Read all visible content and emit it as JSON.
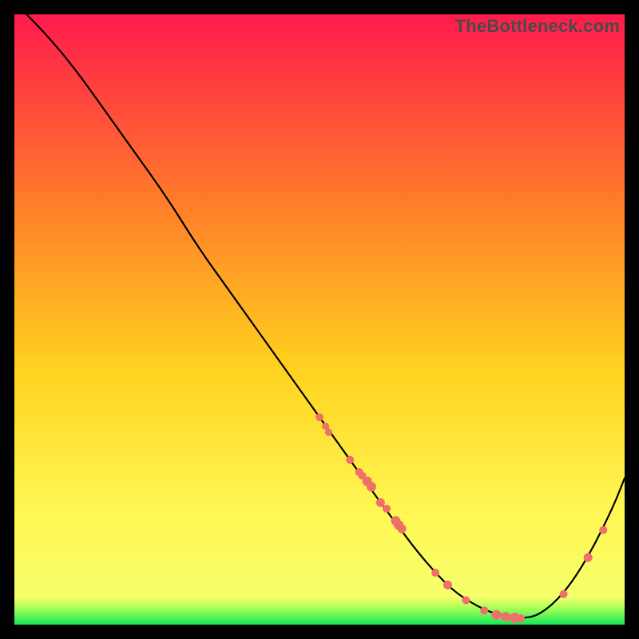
{
  "watermark": "TheBottleneck.com",
  "colors": {
    "gradient_top": "#ff1a4d",
    "gradient_mid1": "#ff7a2a",
    "gradient_mid2": "#ffd21f",
    "gradient_mid3": "#fff855",
    "gradient_bottom": "#15e85a",
    "curve": "#000000",
    "dots": "#ef6f6a",
    "frame": "#000000"
  },
  "chart_data": {
    "type": "line",
    "title": "",
    "xlabel": "",
    "ylabel": "",
    "xlim": [
      0,
      100
    ],
    "ylim": [
      0,
      100
    ],
    "grid": false,
    "legend": false,
    "series": [
      {
        "name": "bottleneck-curve",
        "x": [
          2,
          5,
          10,
          15,
          20,
          25,
          30,
          35,
          40,
          45,
          50,
          55,
          60,
          63,
          66,
          69,
          72,
          75,
          78,
          81,
          83,
          86,
          90,
          94,
          98,
          100
        ],
        "y": [
          100,
          97,
          91,
          84,
          77,
          70,
          62,
          55,
          48,
          41,
          34,
          27,
          20,
          16,
          12,
          8.5,
          5.5,
          3.5,
          2,
          1.3,
          1,
          1.5,
          5,
          11,
          19,
          24
        ]
      }
    ],
    "scatter_points": {
      "name": "highlighted-points",
      "x": [
        50,
        51,
        51.5,
        55,
        56.5,
        57,
        57.8,
        58.5,
        60,
        61,
        62.5,
        63,
        63.5,
        69,
        71,
        74,
        77,
        79,
        80.5,
        82,
        83,
        90,
        94,
        96.5
      ],
      "y": [
        34,
        32.5,
        31.5,
        27,
        25,
        24.4,
        23.5,
        22.6,
        20,
        19,
        17,
        16.3,
        15.7,
        8.5,
        6.5,
        4,
        2.3,
        1.6,
        1.3,
        1.1,
        1,
        5,
        11,
        15.5
      ],
      "radius": [
        5,
        4.5,
        4.5,
        5,
        5,
        5,
        6,
        6,
        5.5,
        5,
        6,
        6,
        5.5,
        5,
        5.5,
        5,
        5,
        6,
        6,
        6.5,
        5,
        5,
        5.5,
        5
      ]
    }
  }
}
